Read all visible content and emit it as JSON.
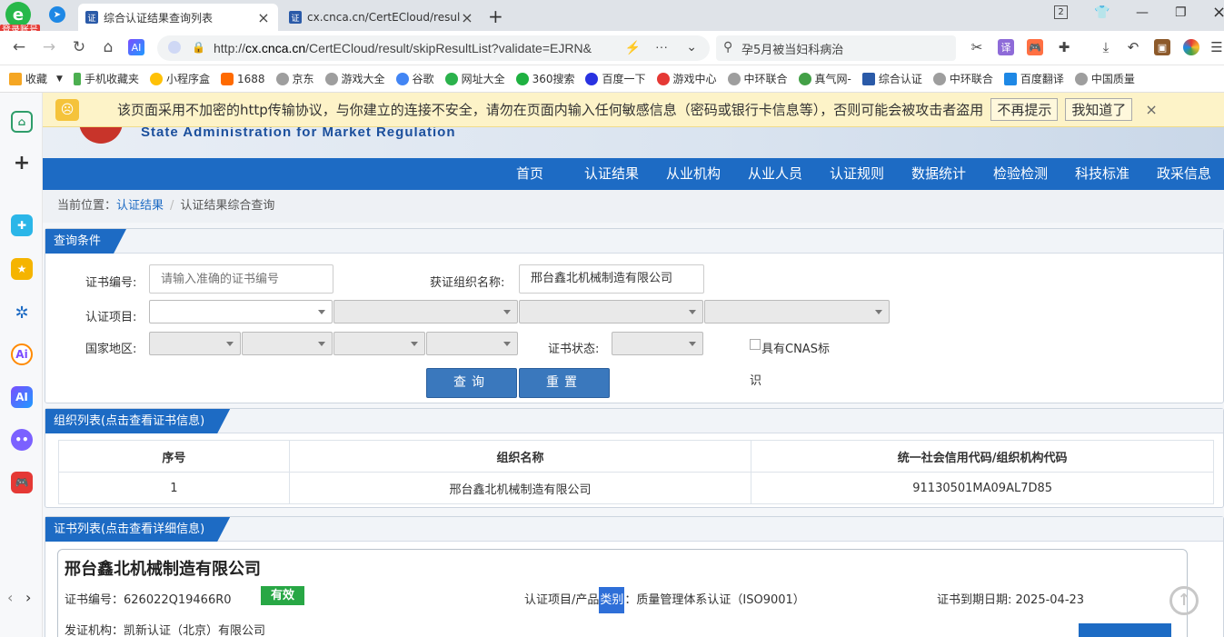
{
  "browser": {
    "login_badge": "登录账号",
    "tabs": [
      {
        "label": "综合认证结果查询列表",
        "active": true
      },
      {
        "label": "cx.cnca.cn/CertECloud/resul",
        "active": false
      }
    ],
    "window_count": "2",
    "url_prefix": "http://",
    "url_host": "cx.cnca.cn",
    "url_path": "/CertECloud/result/skipResultList?validate=EJRN&",
    "search_text": "孕5月被当妇科病治",
    "translate_label": "译",
    "ai_label": "AI"
  },
  "bookmarks": [
    {
      "label": "收藏",
      "color": "#f5a623"
    },
    {
      "label": "手机收藏夹",
      "color": "#4caf50"
    },
    {
      "label": "小程序盒",
      "color": "#ffc107"
    },
    {
      "label": "1688",
      "color": "#ff6a00"
    },
    {
      "label": "京东",
      "color": "#9e9e9e"
    },
    {
      "label": "游戏大全",
      "color": "#9e9e9e"
    },
    {
      "label": "谷歌",
      "color": "#4285f4"
    },
    {
      "label": "网址大全",
      "color": "#2bb24c"
    },
    {
      "label": "360搜索",
      "color": "#1fb141"
    },
    {
      "label": "百度一下",
      "color": "#2932e1"
    },
    {
      "label": "游戏中心",
      "color": "#e53935"
    },
    {
      "label": "中环联合",
      "color": "#9e9e9e"
    },
    {
      "label": "真气网-",
      "color": "#43a047"
    },
    {
      "label": "综合认证",
      "color": "#2a5aa8"
    },
    {
      "label": "中环联合",
      "color": "#9e9e9e"
    },
    {
      "label": "百度翻译",
      "color": "#1e88e5"
    },
    {
      "label": "中国质量",
      "color": "#9e9e9e"
    }
  ],
  "warning": {
    "text": "该页面采用不加密的http传输协议，与你建立的连接不安全，请勿在页面内输入任何敏感信息（密码或银行卡信息等），否则可能会被攻击者盗用",
    "btn_dismiss": "不再提示",
    "btn_ok": "我知道了",
    "close": "×"
  },
  "site": {
    "banner_en": "State Administration for Market Regulation",
    "nav": [
      "首页",
      "认证结果",
      "从业机构",
      "从业人员",
      "认证规则",
      "数据统计",
      "检验检测",
      "科技标准",
      "政采信息"
    ],
    "breadcrumb": {
      "prefix": "当前位置：",
      "link": "认证结果",
      "sep": "/",
      "current": "认证结果综合查询"
    }
  },
  "query": {
    "title": "查询条件",
    "cert_no_label": "证书编号:",
    "cert_no_placeholder": "请输入准确的证书编号",
    "org_label": "获证组织名称:",
    "org_value": "邢台鑫北机械制造有限公司",
    "project_label": "认证项目:",
    "region_label": "国家地区:",
    "status_label": "证书状态:",
    "cnas_label_1": "具有CNAS标",
    "cnas_label_2": "识",
    "btn_query": "查询",
    "btn_reset": "重置"
  },
  "org_list": {
    "title": "组织列表(点击查看证书信息)",
    "columns": [
      "序号",
      "组织名称",
      "统一社会信用代码/组织机构代码"
    ],
    "rows": [
      [
        "1",
        "邢台鑫北机械制造有限公司",
        "91130501MA09AL7D85"
      ]
    ]
  },
  "cert_list": {
    "title": "证书列表(点击查看详细信息)",
    "company": "邢台鑫北机械制造有限公司",
    "cert_no": "证书编号：626022Q19466R0",
    "status": "有效",
    "project_prefix": "认证项目/产品",
    "project_hl": "类别",
    "project_value": "：质量管理体系认证（ISO9001）",
    "expiry": "证书到期日期: 2025-04-23",
    "issuer": "发证机构：凯新认证（北京）有限公司"
  }
}
